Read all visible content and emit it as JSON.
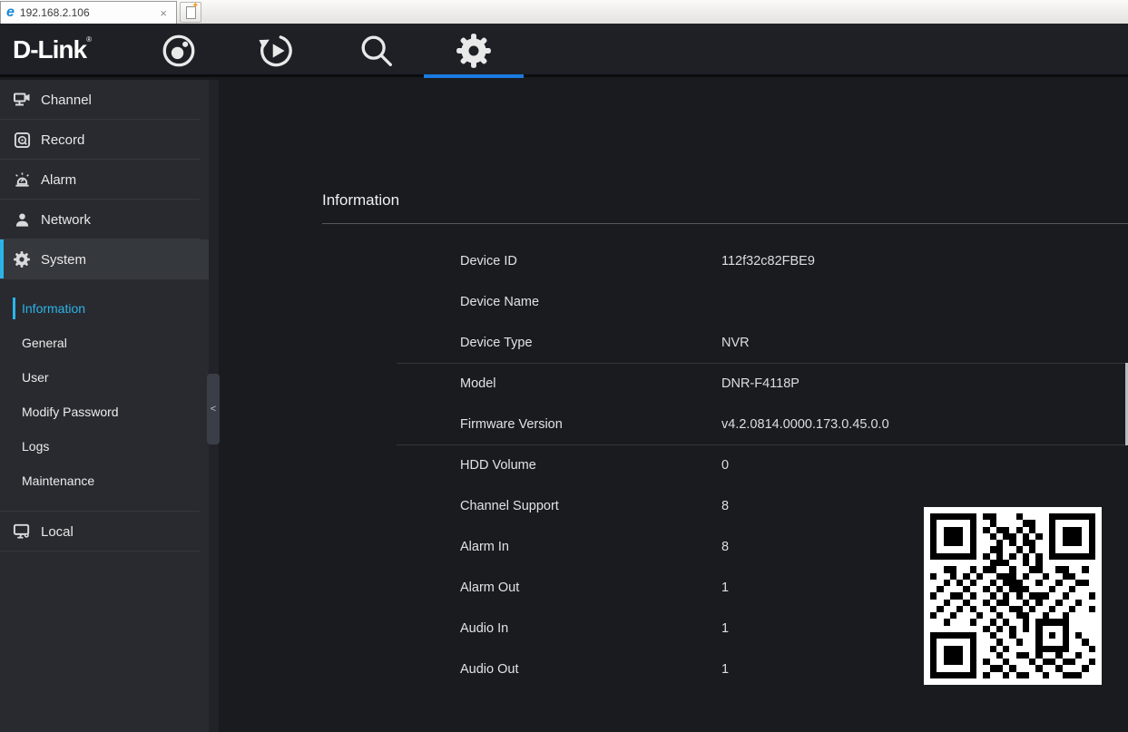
{
  "browser": {
    "tab_title": "192.168.2.106",
    "close_glyph": "×",
    "new_tab_star": "✦",
    "ie_glyph": "e"
  },
  "header": {
    "brand": "D-Link",
    "reg_mark": "®",
    "accent_underline": "#1a7be0",
    "nav": [
      {
        "icon": "live-view-icon",
        "active": false
      },
      {
        "icon": "playback-icon",
        "active": false
      },
      {
        "icon": "search-icon",
        "active": false
      },
      {
        "icon": "settings-icon",
        "active": true
      }
    ]
  },
  "sidebar": {
    "items": [
      {
        "label": "Channel",
        "icon": "channel-icon",
        "active": false
      },
      {
        "label": "Record",
        "icon": "record-icon",
        "active": false
      },
      {
        "label": "Alarm",
        "icon": "alarm-icon",
        "active": false
      },
      {
        "label": "Network",
        "icon": "network-icon",
        "active": false
      },
      {
        "label": "System",
        "icon": "system-gear-icon",
        "active": true
      }
    ],
    "system_submenu": [
      {
        "label": "Information",
        "active": true
      },
      {
        "label": "General",
        "active": false
      },
      {
        "label": "User",
        "active": false
      },
      {
        "label": "Modify Password",
        "active": false
      },
      {
        "label": "Logs",
        "active": false
      },
      {
        "label": "Maintenance",
        "active": false
      }
    ],
    "local_label": "Local",
    "collapse_glyph": "<",
    "active_color": "#2cb4e8"
  },
  "main": {
    "title": "Information",
    "rows": [
      {
        "label": "Device ID",
        "value": "112f32c82FBE9"
      },
      {
        "label": "Device Name",
        "value": ""
      },
      {
        "label": "Device Type",
        "value": "NVR"
      },
      {
        "label": "Model",
        "value": "DNR-F4118P"
      },
      {
        "label": "Firmware Version",
        "value": "v4.2.0814.0000.173.0.45.0.0"
      },
      {
        "label": "HDD Volume",
        "value": "0"
      },
      {
        "label": "Channel Support",
        "value": "8"
      },
      {
        "label": "Alarm In",
        "value": "8"
      },
      {
        "label": "Alarm Out",
        "value": "1"
      },
      {
        "label": "Audio In",
        "value": "1"
      },
      {
        "label": "Audio Out",
        "value": "1"
      }
    ]
  },
  "qr": {
    "dark": "#000000",
    "light": "#ffffff",
    "matrix": [
      "1111111011000100001111111",
      "1000001001000011001000001",
      "1011101010110101001011101",
      "1011101001011010101011101",
      "1011101000101011001011101",
      "1000001001100101001000001",
      "1111111010101010101111111",
      "0000000001110010100000000",
      "0011001011001001100110010",
      "1001010100111010010011000",
      "0010101001011100100100110",
      "0100010010101110001001000",
      "1001101001010101110010001",
      "0010010010110010100100100",
      "0100101001001101001001001",
      "1001000100100110010010000",
      "0010001001010010111110000",
      "0000000010101010100010000",
      "1111111001001000101010100",
      "1000001000100100100010010",
      "1011101001010000111110001",
      "1011101000100110100100100",
      "1011101010010001011011001",
      "1000001001101000100100010",
      "1111111010010110010011100"
    ]
  }
}
